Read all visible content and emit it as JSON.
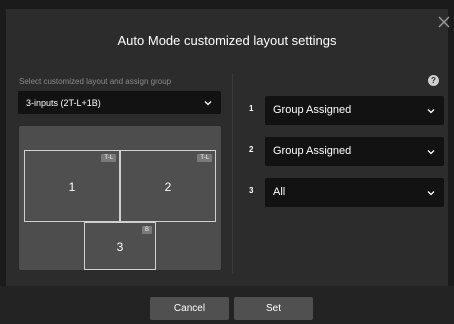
{
  "dialog": {
    "title": "Auto Mode customized layout settings",
    "close_icon": "close-icon",
    "help_icon": "?"
  },
  "left": {
    "label": "Select customized layout and assign group",
    "selected_layout": "3-inputs (2T-L+1B)",
    "tiles": [
      {
        "number": "1",
        "tag": "T-L"
      },
      {
        "number": "2",
        "tag": "T-L"
      },
      {
        "number": "3",
        "tag": "B"
      }
    ]
  },
  "right": {
    "groups": [
      {
        "number": "1",
        "value": "Group Assigned"
      },
      {
        "number": "2",
        "value": "Group Assigned"
      },
      {
        "number": "3",
        "value": "All"
      }
    ]
  },
  "footer": {
    "cancel_label": "Cancel",
    "set_label": "Set"
  },
  "colors": {
    "dialog_bg": "#2c2c2c",
    "select_bg": "#121212",
    "button_bg": "#505050"
  }
}
